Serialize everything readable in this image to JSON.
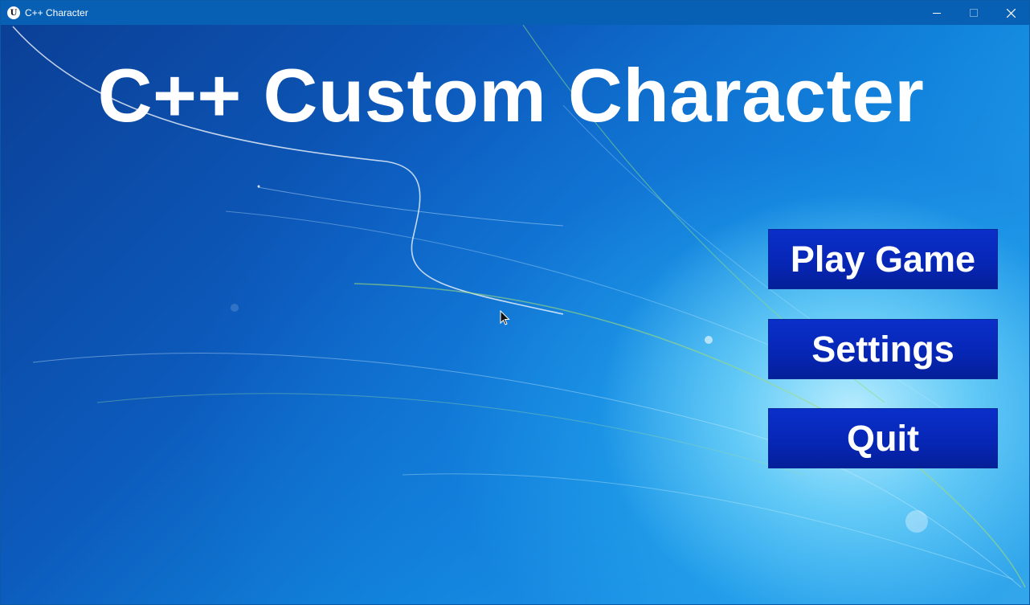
{
  "window": {
    "title": "C++ Character",
    "logo_glyph": "U",
    "controls": [
      "minimize-icon",
      "maximize-icon",
      "close-icon"
    ]
  },
  "menu": {
    "title": "C++ Custom Character",
    "buttons": {
      "play": "Play Game",
      "settings": "Settings",
      "quit": "Quit"
    },
    "button_color": "#0626b4",
    "title_color": "#ffffff"
  }
}
